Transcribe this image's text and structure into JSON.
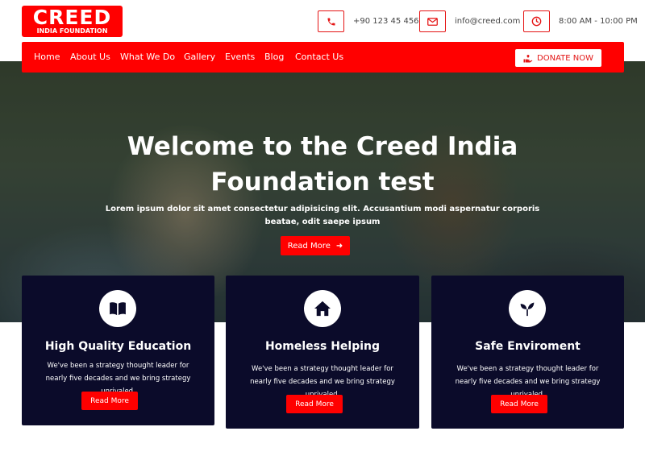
{
  "logo": {
    "main": "CREED",
    "sub": "INDIA FOUNDATION"
  },
  "contact": {
    "phone": "+90 123 45 456",
    "email": "info@creed.com",
    "hours": "8:00 AM - 10:00 PM",
    "icons": [
      "phone-icon",
      "envelope-icon",
      "clock-icon"
    ]
  },
  "nav": {
    "items": [
      "Home",
      "About Us",
      "What We Do",
      "Gallery",
      "Events",
      "Blog",
      "Contact Us"
    ],
    "donate_label": "DONATE NOW"
  },
  "hero": {
    "title": "Welcome to the Creed India Foundation test",
    "text": "Lorem ipsum dolor sit amet consectetur adipisicing elit. Accusantium modi aspernatur corporis beatae, odit saepe ipsum",
    "button_label": "Read More",
    "button_icon": "arrow-right-icon"
  },
  "features": [
    {
      "icon": "book-icon",
      "title": "High Quality Education",
      "desc": "We've been a strategy thought leader for nearly five decades and we bring strategy unrivaled.",
      "button": "Read More"
    },
    {
      "icon": "home-icon",
      "title": "Homeless Helping",
      "desc": "We've been a strategy thought leader for nearly five decades and we bring strategy unrivaled.",
      "button": "Read More"
    },
    {
      "icon": "sprout-icon",
      "title": "Safe Enviroment",
      "desc": "We've been a strategy thought leader for nearly five decades and we bring strategy unrivaled.",
      "button": "Read More"
    }
  ],
  "colors": {
    "brand_red": "#ff0000",
    "card_navy": "#0b0b2a",
    "white": "#ffffff"
  }
}
